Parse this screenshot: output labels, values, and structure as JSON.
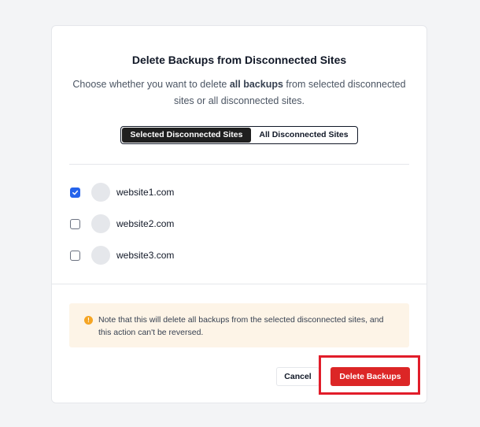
{
  "dialog": {
    "title": "Delete Backups from Disconnected Sites",
    "description_pre": "Choose whether you want to delete ",
    "description_bold": "all backups",
    "description_post": " from selected disconnected sites or all disconnected sites.",
    "tabs": [
      {
        "label": "Selected Disconnected Sites",
        "active": true
      },
      {
        "label": "All Disconnected Sites",
        "active": false
      }
    ],
    "sites": [
      {
        "name": "website1.com",
        "checked": true
      },
      {
        "name": "website2.com",
        "checked": false
      },
      {
        "name": "website3.com",
        "checked": false
      }
    ],
    "note": "Note that this will delete all backups from the selected disconnected sites, and this action can't be reversed.",
    "note_icon": "warning-icon",
    "cancel_label": "Cancel",
    "delete_label": "Delete Backups"
  },
  "colors": {
    "accent": "#2563eb",
    "danger": "#dc2626",
    "highlight": "#e11d2a",
    "warning": "#f5a524"
  }
}
